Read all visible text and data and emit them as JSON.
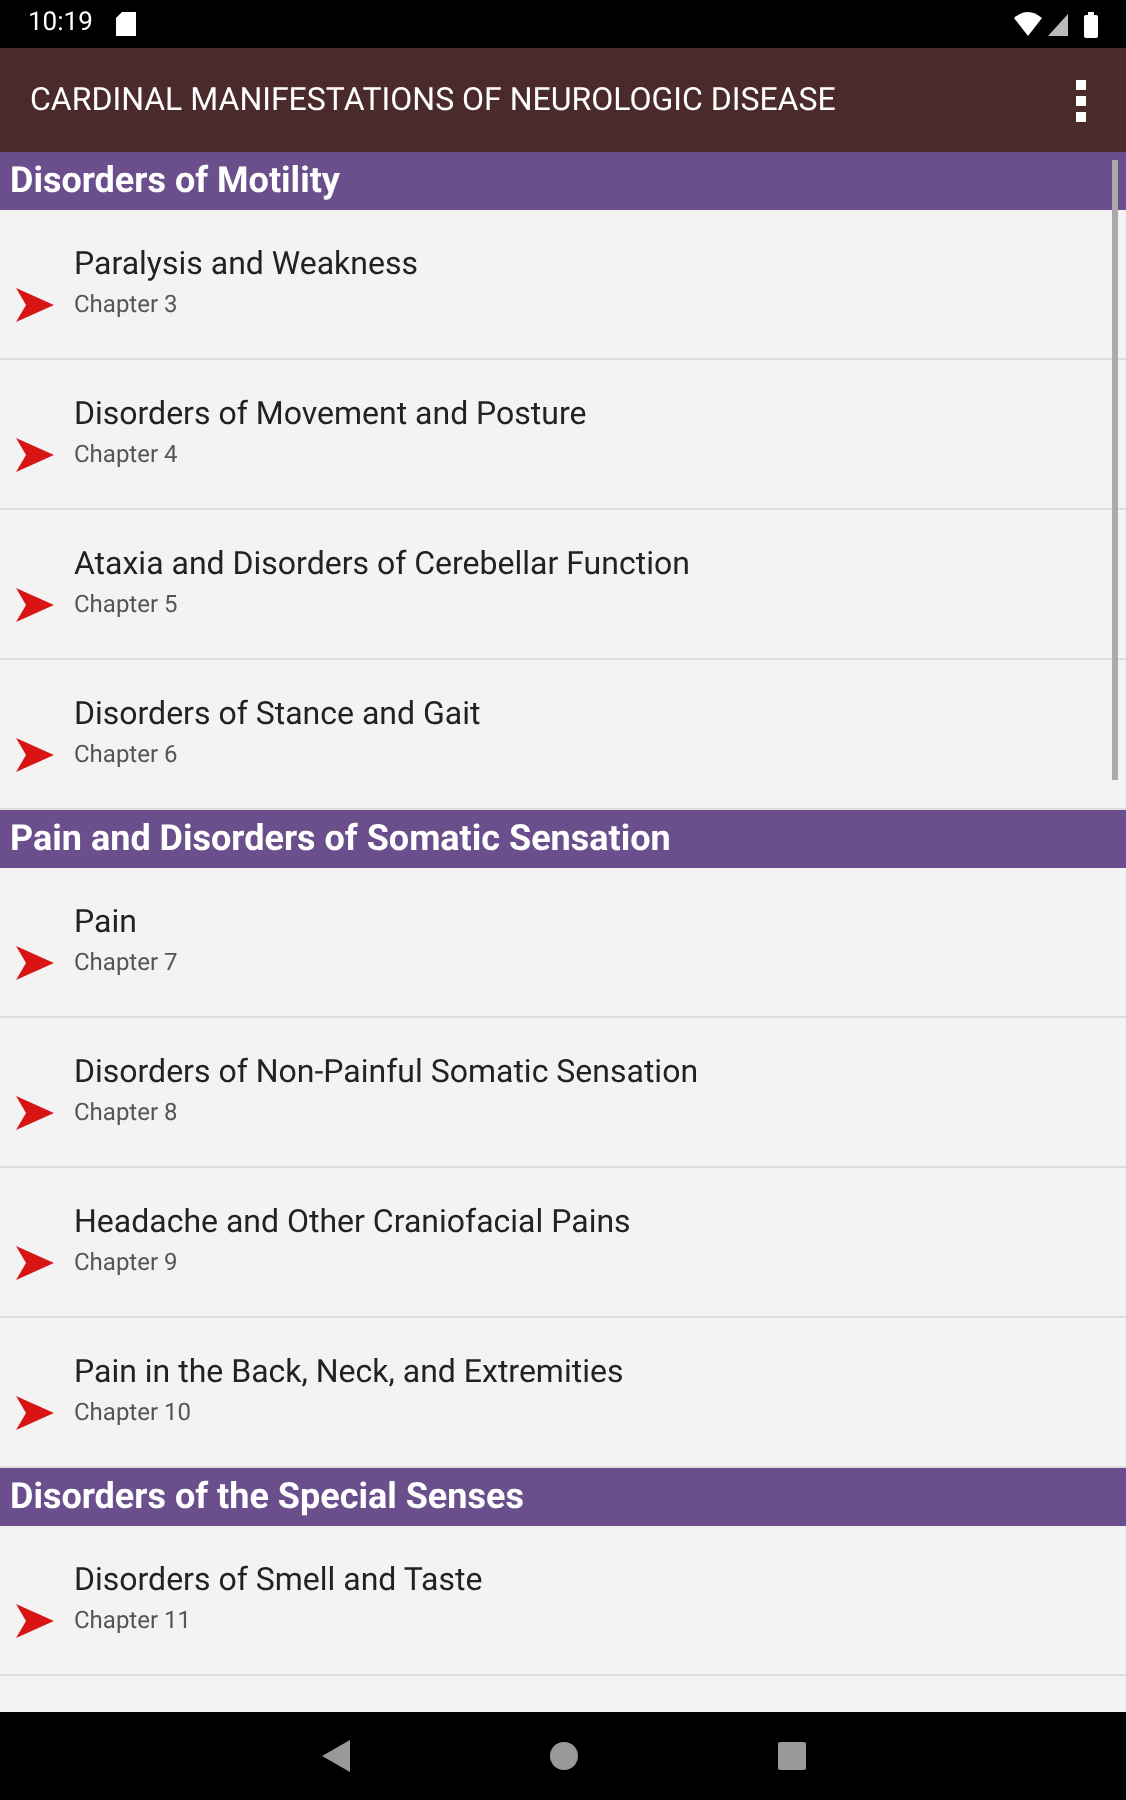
{
  "status_bar": {
    "time": "10:19"
  },
  "app_bar": {
    "title": "CARDINAL MANIFESTATIONS OF NEUROLOGIC DISEASE"
  },
  "sections": [
    {
      "title": "Disorders of Motility",
      "items": [
        {
          "title": "Paralysis and Weakness",
          "subtitle": "Chapter 3"
        },
        {
          "title": "Disorders of Movement and Posture",
          "subtitle": "Chapter 4"
        },
        {
          "title": "Ataxia and Disorders of Cerebellar Function",
          "subtitle": "Chapter 5"
        },
        {
          "title": "Disorders of Stance and Gait",
          "subtitle": "Chapter 6"
        }
      ]
    },
    {
      "title": "Pain and Disorders of Somatic Sensation",
      "items": [
        {
          "title": "Pain",
          "subtitle": "Chapter 7"
        },
        {
          "title": "Disorders of Non-Painful Somatic Sensation",
          "subtitle": "Chapter 8"
        },
        {
          "title": "Headache and Other Craniofacial Pains",
          "subtitle": "Chapter 9"
        },
        {
          "title": "Pain in the Back, Neck, and Extremities",
          "subtitle": "Chapter 10"
        }
      ]
    },
    {
      "title": "Disorders of the Special Senses",
      "items": [
        {
          "title": "Disorders of Smell and Taste",
          "subtitle": "Chapter 11"
        }
      ]
    }
  ]
}
